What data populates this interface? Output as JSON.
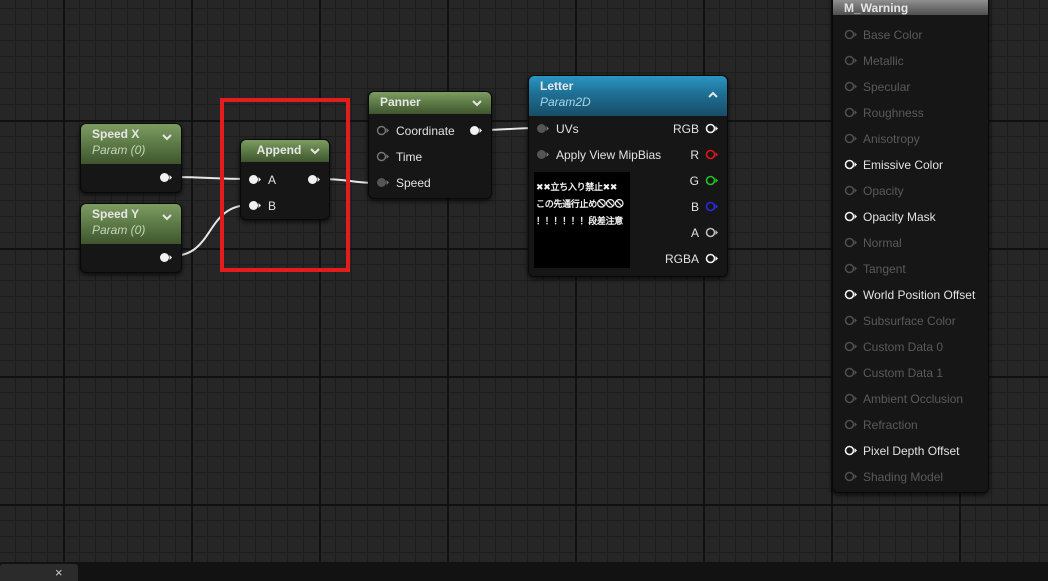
{
  "nodes": {
    "speed_x": {
      "title": "Speed X",
      "subtitle": "Param (0)"
    },
    "speed_y": {
      "title": "Speed Y",
      "subtitle": "Param (0)"
    },
    "append": {
      "title": "Append",
      "pin_a": "A",
      "pin_b": "B"
    },
    "panner": {
      "title": "Panner",
      "pins": [
        "Coordinate",
        "Time",
        "Speed"
      ]
    },
    "letter": {
      "title": "Letter",
      "subtitle": "Param2D",
      "inputs": [
        "UVs",
        "Apply View MipBias"
      ],
      "outputs": [
        "RGB",
        "R",
        "G",
        "B",
        "A",
        "RGBA"
      ],
      "texture_lines": [
        "✖✖立ち入り禁止✖✖",
        "この先通行止め🛇🛇🛇",
        "！！！！！！段差注意"
      ]
    },
    "material": {
      "title": "M_Warning",
      "pins": [
        {
          "label": "Base Color",
          "active": false
        },
        {
          "label": "Metallic",
          "active": false
        },
        {
          "label": "Specular",
          "active": false
        },
        {
          "label": "Roughness",
          "active": false
        },
        {
          "label": "Anisotropy",
          "active": false
        },
        {
          "label": "Emissive Color",
          "active": true
        },
        {
          "label": "Opacity",
          "active": false
        },
        {
          "label": "Opacity Mask",
          "active": true
        },
        {
          "label": "Normal",
          "active": false
        },
        {
          "label": "Tangent",
          "active": false
        },
        {
          "label": "World Position Offset",
          "active": true
        },
        {
          "label": "Subsurface Color",
          "active": false
        },
        {
          "label": "Custom Data 0",
          "active": false
        },
        {
          "label": "Custom Data 1",
          "active": false
        },
        {
          "label": "Ambient Occlusion",
          "active": false
        },
        {
          "label": "Refraction",
          "active": false
        },
        {
          "label": "Pixel Depth Offset",
          "active": true
        },
        {
          "label": "Shading Model",
          "active": false
        }
      ]
    }
  },
  "bottom_tab": {
    "close": "×"
  },
  "colors": {
    "param_header": "#5f7d48",
    "texture_header": "#1e6f93",
    "material_header": "#7e7e7e",
    "highlight": "#e31c1c",
    "pin_r": "#e01515",
    "pin_g": "#23c323",
    "pin_b": "#2a2ae8"
  },
  "icons": {
    "collapse": "chevron-down-icon",
    "expand": "chevron-up-icon",
    "pin": "exec-pin-icon"
  }
}
